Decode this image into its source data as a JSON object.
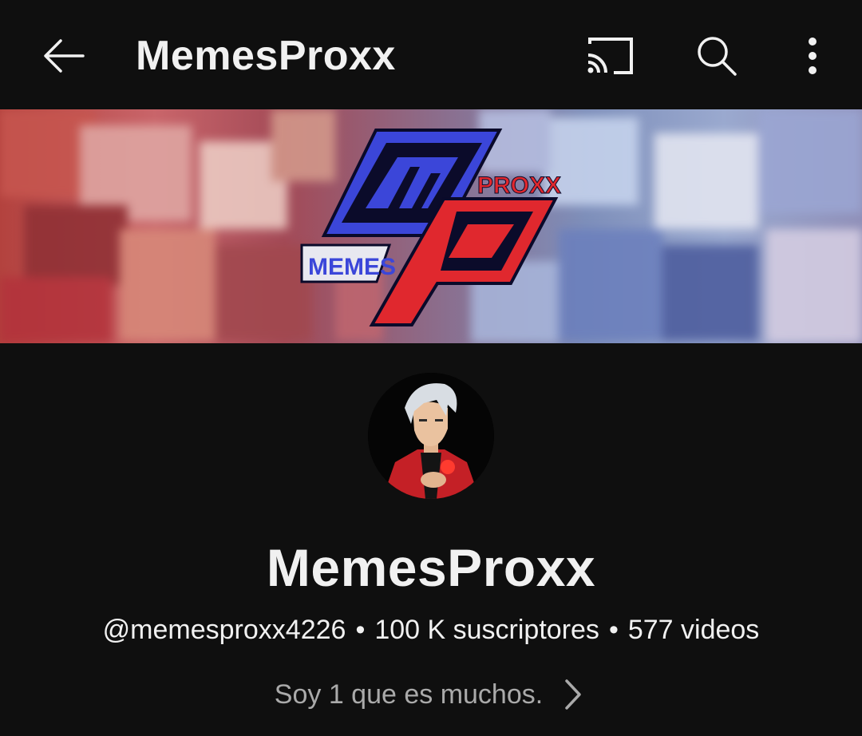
{
  "topbar": {
    "title": "MemesProxx",
    "icons": [
      "back-arrow-icon",
      "cast-icon",
      "search-icon",
      "more-vertical-icon"
    ]
  },
  "banner": {
    "logo_text_top": "PROXX",
    "logo_text_bottom": "MEMES",
    "colors": {
      "logo_blue": "#3b46d9",
      "logo_red": "#e0282e"
    }
  },
  "channel": {
    "name": "MemesProxx",
    "handle": "@memesproxx4226",
    "separator": "•",
    "subscribers": "100 K suscriptores",
    "videos": "577 videos",
    "description": "Soy 1 que es muchos."
  },
  "theme": {
    "background": "#0f0f0f",
    "text_primary": "#f1f1f1",
    "text_secondary": "#aaaaaa"
  }
}
